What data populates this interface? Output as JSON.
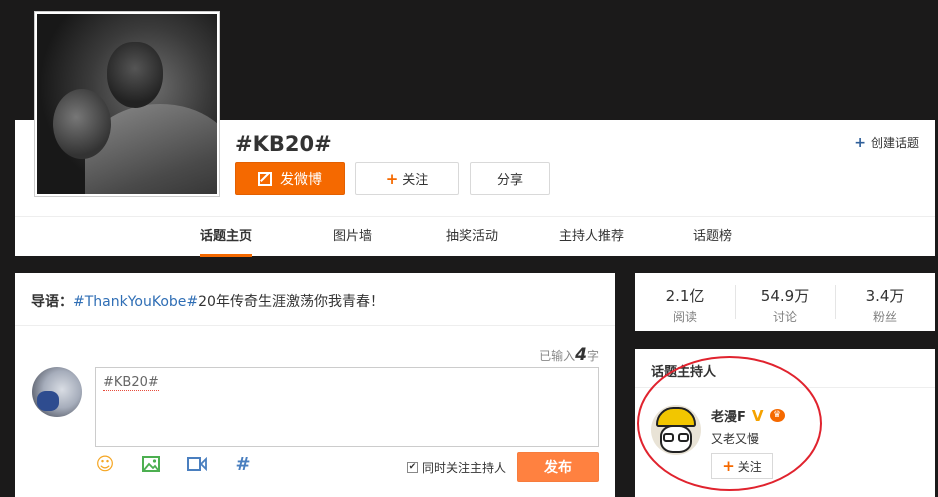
{
  "header": {
    "topic_title": "#KB20#",
    "create_topic_label": "创建话题",
    "post_button_label": "发微博",
    "follow_button_label": "关注",
    "share_button_label": "分享"
  },
  "tabs": [
    {
      "label": "话题主页",
      "active": true
    },
    {
      "label": "图片墙",
      "active": false
    },
    {
      "label": "抽奖活动",
      "active": false
    },
    {
      "label": "主持人推荐",
      "active": false
    },
    {
      "label": "话题榜",
      "active": false
    }
  ],
  "intro": {
    "lead": "导语：",
    "tag": "#ThankYouKobe#",
    "text": "20年传奇生涯激荡你我青春！"
  },
  "composer": {
    "char_count_prefix": "已输入",
    "char_count": "4",
    "char_count_suffix": "字",
    "text": "#KB20#",
    "sync_follow_label": "同时关注主持人",
    "sync_follow_checked": true,
    "publish_label": "发布",
    "tools": [
      "emoji-icon",
      "image-icon",
      "video-icon",
      "hashtag-icon"
    ]
  },
  "stats": [
    {
      "value": "2.1亿",
      "label": "阅读"
    },
    {
      "value": "54.9万",
      "label": "讨论"
    },
    {
      "value": "3.4万",
      "label": "粉丝"
    }
  ],
  "host": {
    "section_title": "话题主持人",
    "name": "老漫F",
    "verified_badge": "V",
    "bio": "又老又慢",
    "follow_label": "关注"
  },
  "colors": {
    "accent_orange": "#f56900",
    "link_blue": "#2f6eb5",
    "highlight_red": "#e0232e"
  }
}
